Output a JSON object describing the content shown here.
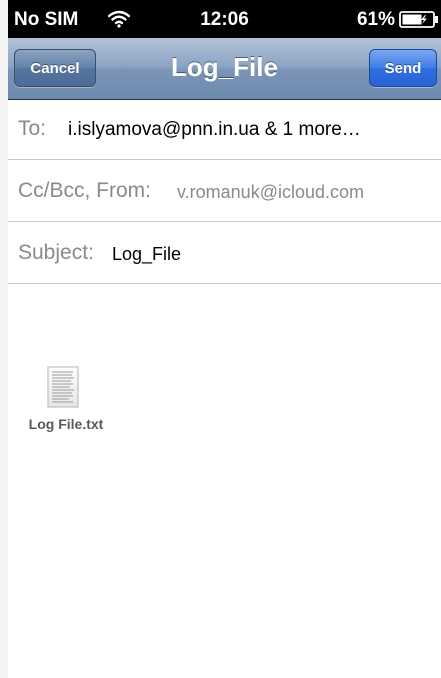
{
  "status_bar": {
    "carrier": "No SIM",
    "time": "12:06",
    "battery": "61%",
    "wifi_icon": "wifi-icon",
    "battery_icon": "battery-icon"
  },
  "nav": {
    "title": "Log_File",
    "cancel_label": "Cancel",
    "send_label": "Send"
  },
  "fields": {
    "to_label": "To:",
    "to_value": "i.islyamova@pnn.in.ua & 1 more…",
    "cc_label": "Cc/Bcc, From:",
    "cc_value": "v.romanuk@icloud.com",
    "subject_label": "Subject:",
    "subject_value": "Log_File"
  },
  "attachment": {
    "file_name": "Log File.txt",
    "icon": "text-file-icon"
  },
  "colors": {
    "nav_bar": "#8aa2c2",
    "send_button": "#3f7ce8",
    "label_gray": "#8a8a8a"
  }
}
